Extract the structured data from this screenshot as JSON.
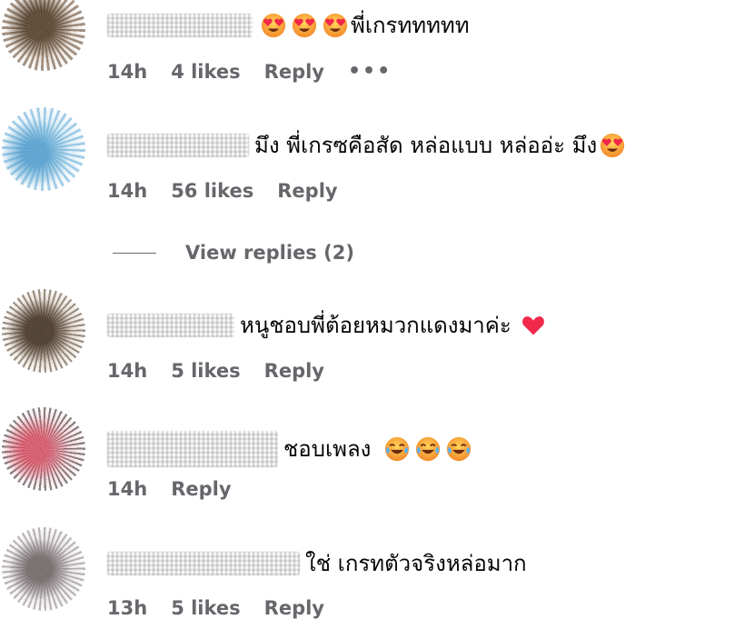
{
  "comments": [
    {
      "text": "พี่เกรททททท",
      "emoji_count_before": 3,
      "emoji_icon": "heart-eyes-emoji-icon",
      "time": "14h",
      "likes": "4 likes",
      "reply": "Reply",
      "more": "•••"
    },
    {
      "text": "มึง พี่เกรซคือสัด หล่อแบบ หล่ออ่ะ มึง",
      "emoji_icon": "heart-eyes-emoji-icon",
      "time": "14h",
      "likes": "56 likes",
      "reply": "Reply",
      "view_replies": "View replies (2)"
    },
    {
      "text": "หนูชอบพี่ต้อยหมวกแดงมาค่ะ",
      "emoji_icon": "red-heart-icon",
      "time": "14h",
      "likes": "5 likes",
      "reply": "Reply"
    },
    {
      "text": "ชอบเพลง",
      "emoji_icon": "laughing-tears-emoji-icon",
      "emoji_count_after": 3,
      "time": "14h",
      "reply": "Reply"
    },
    {
      "text": "ใช่ เกรทตัวจริงหล่อมาก",
      "time": "13h",
      "likes": "5 likes",
      "reply": "Reply"
    }
  ],
  "colors": {
    "meta_text": "#65676b",
    "body_text": "#050505"
  }
}
